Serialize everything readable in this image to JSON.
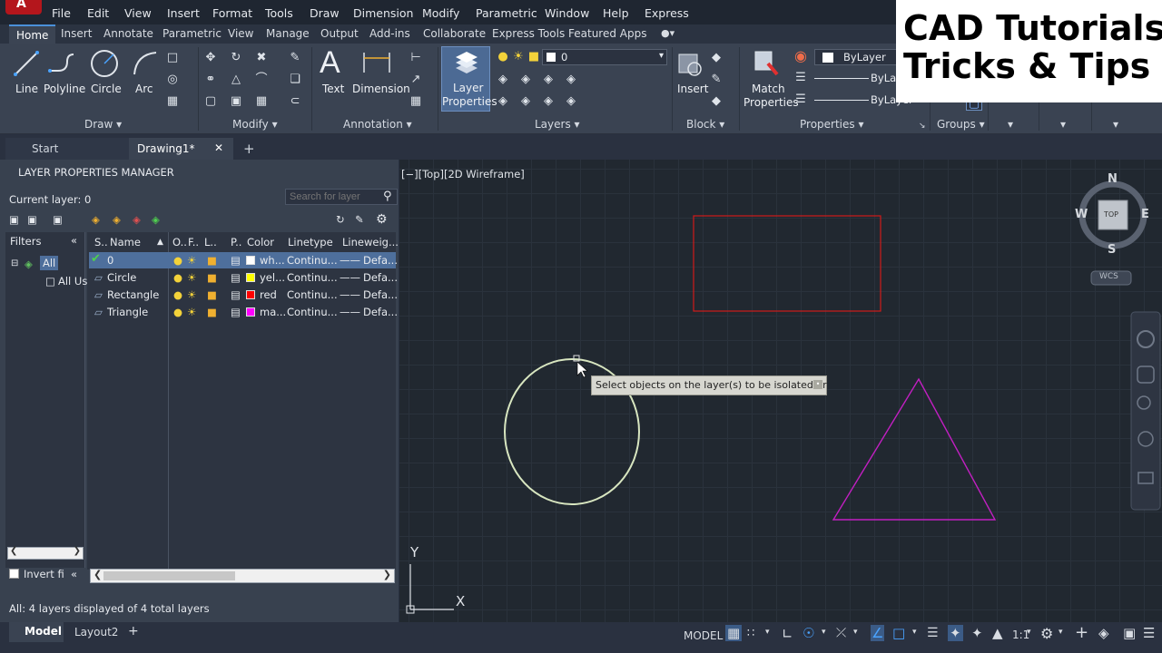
{
  "menu": [
    "File",
    "Edit",
    "View",
    "Insert",
    "Format",
    "Tools",
    "Draw",
    "Dimension",
    "Modify",
    "Parametric",
    "Window",
    "Help",
    "Express"
  ],
  "ribbon_tabs": [
    "Home",
    "Insert",
    "Annotate",
    "Parametric",
    "View",
    "Manage",
    "Output",
    "Add-ins",
    "Collaborate",
    "Express Tools",
    "Featured Apps"
  ],
  "ribbon": {
    "draw": {
      "title": "Draw",
      "line": "Line",
      "polyline": "Polyline",
      "circle": "Circle",
      "arc": "Arc"
    },
    "modify": {
      "title": "Modify"
    },
    "annotation": {
      "title": "Annotation",
      "text": "Text",
      "dimension": "Dimension"
    },
    "layers": {
      "title": "Layers",
      "layer_properties_1": "Layer",
      "layer_properties_2": "Properties",
      "current_layer": "0"
    },
    "block": {
      "title": "Block",
      "insert": "Insert"
    },
    "properties": {
      "title": "Properties",
      "match_1": "Match",
      "match_2": "Properties",
      "color": "ByLayer",
      "linetype": "ByLayer",
      "lineweight": "ByLayer"
    },
    "groups": {
      "title": "Groups"
    }
  },
  "doc_tabs": {
    "start": "Start",
    "drawing": "Drawing1*",
    "add": "+"
  },
  "layer_manager": {
    "title": "LAYER PROPERTIES MANAGER",
    "current_layer": "Current layer: 0",
    "search_placeholder": "Search for layer",
    "filters_label": "Filters",
    "filter_all": "All",
    "filter_all_used": "All Us",
    "invert_filter": "Invert fi",
    "status_text": "All: 4 layers displayed of 4 total layers",
    "columns": [
      "S..",
      "Name",
      "O..",
      "F..",
      "L..",
      "P..",
      "Color",
      "Linetype",
      "Lineweig..."
    ],
    "layers": [
      {
        "name": "0",
        "color_label": "wh...",
        "color": "#ffffff",
        "linetype": "Continu...",
        "lineweight": "Defa..."
      },
      {
        "name": "Circle",
        "color_label": "yel...",
        "color": "#ffff00",
        "linetype": "Continu...",
        "lineweight": "Defa..."
      },
      {
        "name": "Rectangle",
        "color_label": "red",
        "color": "#ff0000",
        "linetype": "Continu...",
        "lineweight": "Defa..."
      },
      {
        "name": "Triangle",
        "color_label": "ma...",
        "color": "#ff00ff",
        "linetype": "Continu...",
        "lineweight": "Defa..."
      }
    ]
  },
  "viewport": {
    "label": "[−][Top][2D Wireframe]",
    "viewcube": {
      "north": "N",
      "south": "S",
      "east": "E",
      "west": "W",
      "face": "TOP",
      "wcs": "WCS"
    },
    "tooltip": "Select objects on the layer(s) to be isolated or",
    "ucs_x": "X",
    "ucs_y": "Y",
    "colors": {
      "rectangle": "#d11a1a",
      "circle": "#d8e6c0",
      "triangle": "#c21fc2"
    }
  },
  "status": {
    "model_tab": "Model",
    "layout_tab": "Layout2",
    "add": "+",
    "model_space": "MODEL",
    "scale": "1:1"
  },
  "watermark": {
    "line1": "CAD Tutorials",
    "line2": "Tricks & Tips"
  }
}
